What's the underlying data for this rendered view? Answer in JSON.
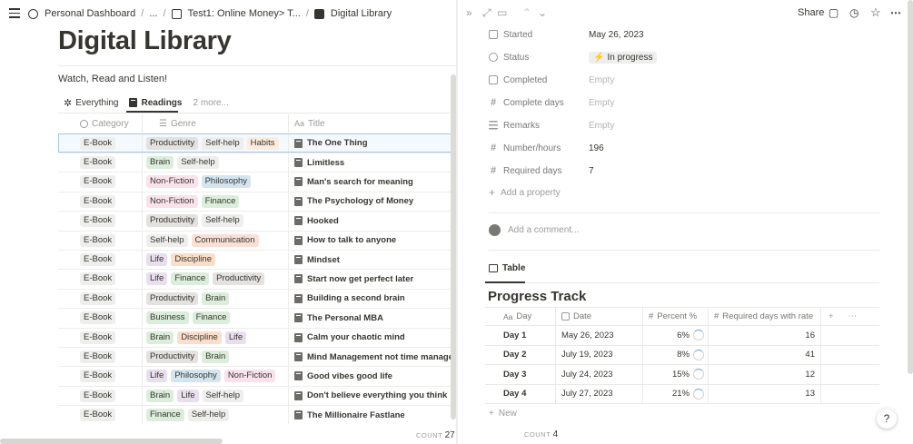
{
  "breadcrumb": {
    "items": [
      "Personal Dashboard",
      "...",
      "Test1: Online Money> T...",
      "Digital Library"
    ],
    "separator": "/"
  },
  "page": {
    "title": "Digital Library",
    "description": "Watch, Read and Listen!"
  },
  "views": {
    "tabs": [
      {
        "label": "Everything",
        "icon": "sparkle-icon"
      },
      {
        "label": "Readings",
        "icon": "book-icon"
      }
    ],
    "more": "2 more..."
  },
  "table": {
    "columns": [
      "Category",
      "Genre",
      "Title"
    ],
    "count_label": "COUNT",
    "count": "27",
    "rows": [
      {
        "category": "E-Book",
        "genres": [
          "Productivity",
          "Self-help",
          "Habits"
        ],
        "title": "The One Thing"
      },
      {
        "category": "E-Book",
        "genres": [
          "Brain",
          "Self-help"
        ],
        "title": "Limitless"
      },
      {
        "category": "E-Book",
        "genres": [
          "Non-Fiction",
          "Philosophy"
        ],
        "title": "Man's search for meaning"
      },
      {
        "category": "E-Book",
        "genres": [
          "Non-Fiction",
          "Finance"
        ],
        "title": "The Psychology of Money"
      },
      {
        "category": "E-Book",
        "genres": [
          "Productivity",
          "Self-help"
        ],
        "title": "Hooked"
      },
      {
        "category": "E-Book",
        "genres": [
          "Self-help",
          "Communication"
        ],
        "title": "How to talk to anyone"
      },
      {
        "category": "E-Book",
        "genres": [
          "Life",
          "Discipline"
        ],
        "title": "Mindset"
      },
      {
        "category": "E-Book",
        "genres": [
          "Life",
          "Finance",
          "Productivity"
        ],
        "title": "Start now get perfect later"
      },
      {
        "category": "E-Book",
        "genres": [
          "Productivity",
          "Brain"
        ],
        "title": "Building a second brain"
      },
      {
        "category": "E-Book",
        "genres": [
          "Business",
          "Finance"
        ],
        "title": "The Personal MBA"
      },
      {
        "category": "E-Book",
        "genres": [
          "Brain",
          "Discipline",
          "Life"
        ],
        "title": "Calm your chaotic mind"
      },
      {
        "category": "E-Book",
        "genres": [
          "Productivity",
          "Brain"
        ],
        "title": "Mind Management not time managen"
      },
      {
        "category": "E-Book",
        "genres": [
          "Life",
          "Philosophy",
          "Non-Fiction"
        ],
        "title": "Good vibes good life"
      },
      {
        "category": "E-Book",
        "genres": [
          "Brain",
          "Life",
          "Self-help"
        ],
        "title": "Don't believe everything you think"
      },
      {
        "category": "E-Book",
        "genres": [
          "Finance",
          "Self-help"
        ],
        "title": "The Millionaire Fastlane"
      }
    ]
  },
  "tag_colors": {
    "Productivity": "#e3e2e0",
    "Self-help": "#eeeeec",
    "Habits": "#fbecdd",
    "Brain": "#dbeddb",
    "Non-Fiction": "#f9e2ec",
    "Philosophy": "#d3e5ef",
    "Finance": "#dbeddb",
    "Communication": "#fadfd5",
    "Life": "#e8deee",
    "Discipline": "#fadec9",
    "Business": "#dbeddb",
    "E-Book": "#eeeeec"
  },
  "peek": {
    "share_label": "Share",
    "properties": [
      {
        "label": "Started",
        "value": "May 26, 2023",
        "icon": "calendar-icon",
        "empty": false
      },
      {
        "label": "Status",
        "value": "In progress",
        "icon": "status-icon",
        "empty": false
      },
      {
        "label": "Completed",
        "value": "Empty",
        "icon": "calendar-icon",
        "empty": true
      },
      {
        "label": "Complete days",
        "value": "Empty",
        "icon": "hash-icon",
        "empty": true
      },
      {
        "label": "Remarks",
        "value": "Empty",
        "icon": "lines-icon",
        "empty": true
      },
      {
        "label": "Number/hours",
        "value": "196",
        "icon": "hash-icon",
        "empty": false
      },
      {
        "label": "Required days",
        "value": "7",
        "icon": "hash-icon",
        "empty": false
      }
    ],
    "add_property": "Add a property",
    "comment_placeholder": "Add a comment...",
    "tab_label": "Table",
    "progress_title": "Progress Track",
    "progress_columns": [
      "Day",
      "Date",
      "Percent %",
      "Required days with rate"
    ],
    "progress_rows": [
      {
        "day": "Day 1",
        "date": "May 26, 2023",
        "percent": "6%",
        "required": "16"
      },
      {
        "day": "Day 2",
        "date": "July 19, 2023",
        "percent": "8%",
        "required": "41"
      },
      {
        "day": "Day 3",
        "date": "July 24, 2023",
        "percent": "15%",
        "required": "12"
      },
      {
        "day": "Day 4",
        "date": "July 27, 2023",
        "percent": "21%",
        "required": "13"
      }
    ],
    "new_label": "New",
    "count_label": "COUNT",
    "count": "4",
    "help": "?"
  }
}
